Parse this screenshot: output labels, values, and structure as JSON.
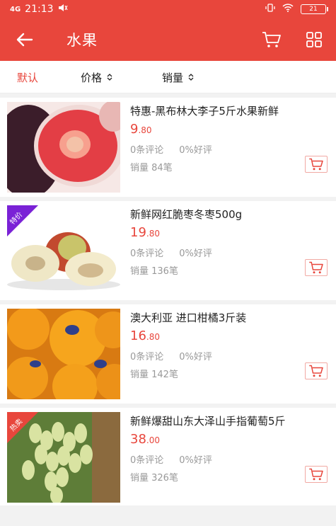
{
  "status": {
    "signal": "4G",
    "time": "21:13",
    "battery": "21"
  },
  "header": {
    "title": "水果"
  },
  "sort": {
    "default_label": "默认",
    "price_label": "价格",
    "sales_label": "销量"
  },
  "colors": {
    "accent": "#e8463c",
    "tag_purple": "#7a22d6",
    "tag_red": "#e8463c"
  },
  "products": [
    {
      "name": "特惠-黑布林大李子5斤水果新鲜",
      "price_int": "9",
      "price_dec": ".80",
      "comments": "0条评论",
      "rating": "0%好评",
      "sales": "销量 84笔",
      "tag": ""
    },
    {
      "name": "新鲜网红脆枣冬枣500g",
      "price_int": "19",
      "price_dec": ".80",
      "comments": "0条评论",
      "rating": "0%好评",
      "sales": "销量 136笔",
      "tag": "特价"
    },
    {
      "name": "澳大利亚 进口柑橘3斤装",
      "price_int": "16",
      "price_dec": ".80",
      "comments": "0条评论",
      "rating": "0%好评",
      "sales": "销量 142笔",
      "tag": ""
    },
    {
      "name": "新鲜爆甜山东大泽山手指葡萄5斤",
      "price_int": "38",
      "price_dec": ".00",
      "comments": "0条评论",
      "rating": "0%好评",
      "sales": "销量 326笔",
      "tag": "热卖"
    }
  ]
}
